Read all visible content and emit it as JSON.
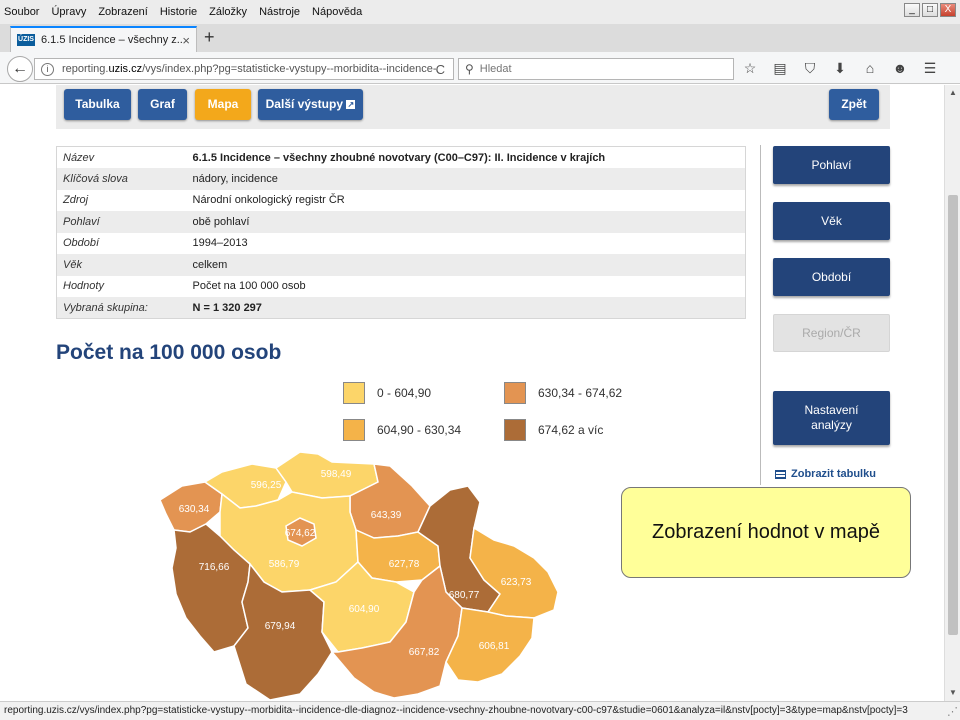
{
  "browser": {
    "menu": [
      "Soubor",
      "Úpravy",
      "Zobrazení",
      "Historie",
      "Záložky",
      "Nástroje",
      "Nápověda"
    ],
    "window_controls": {
      "minimize": "_",
      "maximize": "□",
      "close": "X"
    },
    "tab": {
      "favicon": "ÚZIS",
      "title": "6.1.5 Incidence – všechny z...",
      "close": "×"
    },
    "new_tab": "+",
    "back": "←",
    "url_prefix": "reporting.",
    "url_domain": "uzis.cz",
    "url_rest": "/vys/index.php?pg=statisticke-vystupy--morbidita--incidence-dle",
    "reload": "C",
    "search_placeholder": "Hledat",
    "toolbar_icons": [
      "star-icon",
      "reading-list-icon",
      "pocket-icon",
      "download-icon",
      "home-icon",
      "smiley-icon",
      "menu-icon"
    ]
  },
  "page": {
    "view_buttons": [
      {
        "label": "Tabulka",
        "active": false
      },
      {
        "label": "Graf",
        "active": false
      },
      {
        "label": "Mapa",
        "active": true
      },
      {
        "label": "Další výstupy",
        "active": false
      }
    ],
    "back_button": "Zpět",
    "info_rows": [
      {
        "key": "Název",
        "value": "6.1.5 Incidence – všechny zhoubné novotvary (C00–C97): II. Incidence v krajích"
      },
      {
        "key": "Klíčová slova",
        "value": "nádory, incidence"
      },
      {
        "key": "Zdroj",
        "value": "Národní onkologický registr ČR"
      },
      {
        "key": "Pohlaví",
        "value": "obě pohlaví"
      },
      {
        "key": "Období",
        "value": "1994–2013"
      },
      {
        "key": "Věk",
        "value": "celkem"
      },
      {
        "key": "Hodnoty",
        "value": "Počet na 100 000 osob"
      },
      {
        "key": "Vybraná skupina:",
        "value": "N = 1 320 297"
      }
    ],
    "side_buttons": [
      {
        "label": "Pohlaví",
        "disabled": false
      },
      {
        "label": "Věk",
        "disabled": false
      },
      {
        "label": "Období",
        "disabled": false
      },
      {
        "label": "Region/ČR",
        "disabled": true
      },
      {
        "label": "Nastavení analýzy",
        "disabled": false
      }
    ],
    "show_table_link": "Zobrazit tabulku",
    "map_title": "Počet na 100 000 osob",
    "legend": [
      {
        "label": "0 - 604,90",
        "color": "#fcd569"
      },
      {
        "label": "604,90 - 630,34",
        "color": "#f4b349"
      },
      {
        "label": "630,34 - 674,62",
        "color": "#e39452"
      },
      {
        "label": "674,62 a víc",
        "color": "#ac6c37"
      }
    ],
    "regions": [
      {
        "value": "630,34",
        "color": "#e39452"
      },
      {
        "value": "596,25",
        "color": "#fcd569"
      },
      {
        "value": "598,49",
        "color": "#fcd569"
      },
      {
        "value": "643,39",
        "color": "#e39452"
      },
      {
        "value": "674,62",
        "color": "#e39452"
      },
      {
        "value": "716,66",
        "color": "#ac6c37"
      },
      {
        "value": "586,79",
        "color": "#fcd569"
      },
      {
        "value": "627,78",
        "color": "#f4b349"
      },
      {
        "value": "604,90",
        "color": "#fcd569"
      },
      {
        "value": "680,77",
        "color": "#ac6c37"
      },
      {
        "value": "623,73",
        "color": "#f4b349"
      },
      {
        "value": "679,94",
        "color": "#ac6c37"
      },
      {
        "value": "667,82",
        "color": "#e39452"
      },
      {
        "value": "606,81",
        "color": "#f4b349"
      }
    ],
    "callout": "Zobrazení hodnot v mapě"
  },
  "status_url": "reporting.uzis.cz/vys/index.php?pg=statisticke-vystupy--morbidita--incidence-dle-diagnoz--incidence-vsechny-zhoubne-novotvary-c00-c97&studie=0601&analyza=il&nstv[pocty]=3&type=map&nstv[pocty]=3"
}
